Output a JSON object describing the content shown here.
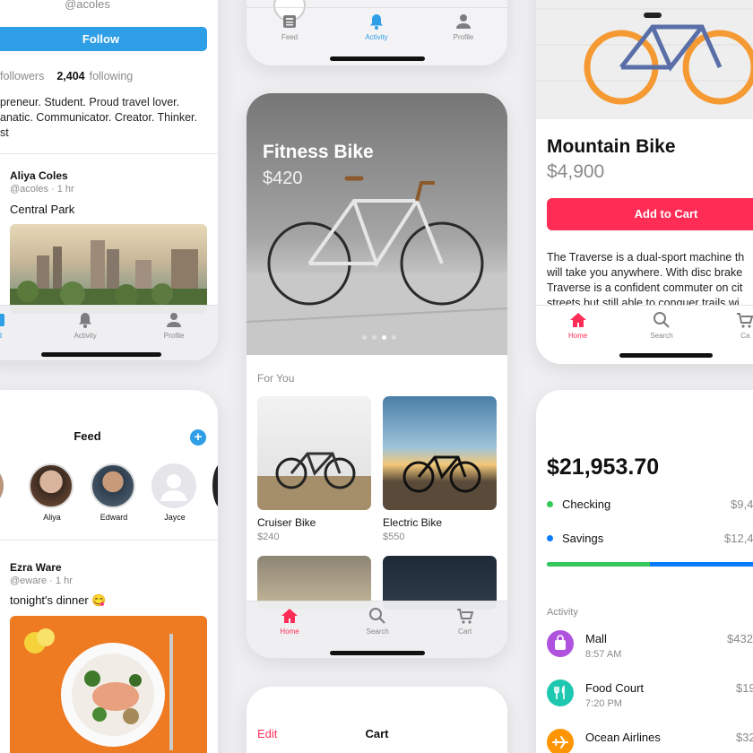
{
  "profile": {
    "handle": "@acoles",
    "follow_label": "Follow",
    "followers_label": "followers",
    "following_count": "2,404",
    "following_label": "following",
    "bio_lines": [
      "preneur. Student. Proud travel lover.",
      "anatic. Communicator. Creator. Thinker.",
      "st"
    ],
    "post": {
      "author": "Aliya Coles",
      "meta": "@acoles · 1 hr",
      "text": "Central Park"
    },
    "tabs": [
      "ed",
      "Activity",
      "Profile"
    ]
  },
  "feed": {
    "title": "Feed",
    "stories": [
      "Aliya",
      "Edward",
      "Jayce"
    ],
    "post": {
      "author": "Ezra Ware",
      "meta": "@eware · 1 hr",
      "text": "tonight's dinner 😋"
    }
  },
  "top_center": {
    "tabs": [
      "Feed",
      "Activity",
      "Profile"
    ]
  },
  "shop": {
    "hero": {
      "title": "Fitness Bike",
      "price": "$420"
    },
    "section_title": "For You",
    "products": [
      {
        "name": "Cruiser Bike",
        "price": "$240"
      },
      {
        "name": "Electric Bike",
        "price": "$550"
      }
    ],
    "tabs": [
      "Home",
      "Search",
      "Cart"
    ]
  },
  "cart": {
    "edit_label": "Edit",
    "title": "Cart"
  },
  "product": {
    "title": "Mountain Bike",
    "price": "$4,900",
    "add_label": "Add to Cart",
    "description": [
      "The Traverse is a dual-sport machine th",
      "will take you anywhere. With disc brake",
      "Traverse is a confident commuter on cit",
      "streets but still able to conquer trails wi"
    ],
    "tabs": [
      "Home",
      "Search",
      "Ca"
    ]
  },
  "bank": {
    "balance": "$21,953.70",
    "accounts": [
      {
        "name": "Checking",
        "amount": "$9,4",
        "color": "#34c759"
      },
      {
        "name": "Savings",
        "amount": "$12,4",
        "color": "#0a7cff"
      }
    ],
    "activity_label": "Activity",
    "transactions": [
      {
        "name": "Mall",
        "time": "8:57 AM",
        "amount": "$432",
        "color": "#af52de",
        "icon": "bag-icon"
      },
      {
        "name": "Food Court",
        "time": "7:20 PM",
        "amount": "$19",
        "color": "#1ec8b0",
        "icon": "fork-knife-icon"
      },
      {
        "name": "Ocean Airlines",
        "time": "",
        "amount": "$32",
        "color": "#ff9500",
        "icon": "airplane-icon"
      }
    ]
  },
  "colors": {
    "accent_blue": "#2e9fe6",
    "accent_red": "#ff2d55",
    "activity_blue": "#2e9fe6"
  }
}
